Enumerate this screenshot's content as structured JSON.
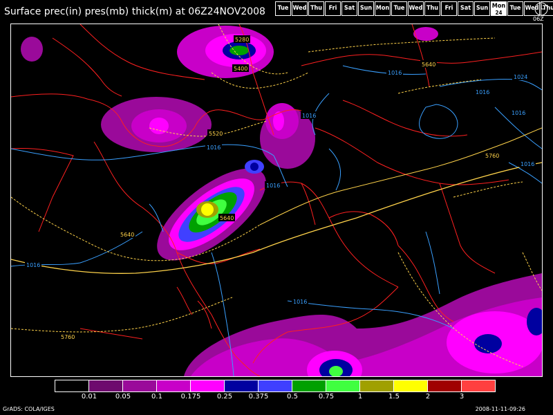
{
  "title": "Surface prec(in) pres(mb) thick(m) at 06Z24NOV2008",
  "days": [
    {
      "label": "Tue"
    },
    {
      "label": "Wed"
    },
    {
      "label": "Thu"
    },
    {
      "label": "Fri"
    },
    {
      "label": "Sat"
    },
    {
      "label": "Sun"
    },
    {
      "label": "Mon"
    },
    {
      "label": "Tue"
    },
    {
      "label": "Wed"
    },
    {
      "label": "Thu"
    },
    {
      "label": "Fri"
    },
    {
      "label": "Sat"
    },
    {
      "label": "Sun"
    },
    {
      "label": "Mon",
      "sub": "24",
      "active": true
    },
    {
      "label": "Tue"
    },
    {
      "label": "Wed"
    },
    {
      "label": "Thu"
    }
  ],
  "clock_label": "06Z",
  "legend": {
    "colors": [
      "#000000",
      "#6e0a6e",
      "#9a0a9a",
      "#c800c8",
      "#ff00ff",
      "#0000a0",
      "#4040ff",
      "#00a000",
      "#40ff40",
      "#a0a000",
      "#ffff00",
      "#a00000",
      "#ff4040"
    ],
    "labels": [
      "0.01",
      "0.05",
      "0.1",
      "0.175",
      "0.25",
      "0.375",
      "0.5",
      "0.75",
      "1",
      "1.5",
      "2",
      "3"
    ]
  },
  "contour_labels": {
    "pressure": [
      "1016",
      "1016",
      "1016",
      "1016",
      "1016",
      "1016",
      "1024",
      "1016",
      "1016",
      "1016"
    ],
    "thickness": [
      "5280",
      "5400",
      "5520",
      "5640",
      "5640",
      "5640",
      "5760",
      "5760"
    ]
  },
  "colors": {
    "pressure_contour": "#3aa0ff",
    "thickness_contour": "#ffd34a",
    "coastline": "#ff2020"
  },
  "footer": {
    "left": "GrADS: COLA/IGES",
    "right": "2008-11-11-09:26"
  }
}
